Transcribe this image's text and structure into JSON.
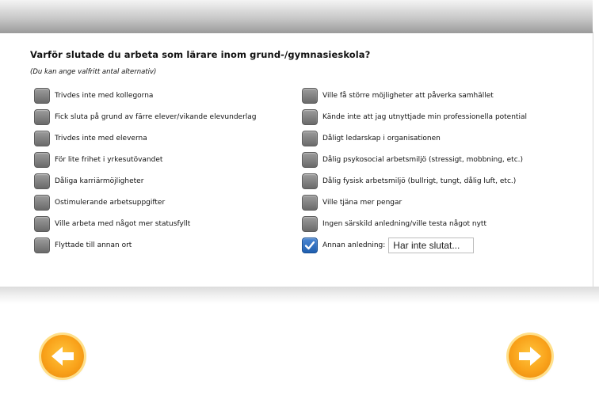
{
  "question": "Varför slutade du arbeta som lärare inom grund-/gymnasieskola?",
  "hint": "(Du kan ange valfritt antal alternativ)",
  "left_options": [
    {
      "label": "Trivdes inte med kollegorna",
      "checked": false
    },
    {
      "label": "Fick sluta på grund av färre elever/vikande elevunderlag",
      "checked": false
    },
    {
      "label": "Trivdes inte med eleverna",
      "checked": false
    },
    {
      "label": "För lite frihet i yrkesutövandet",
      "checked": false
    },
    {
      "label": "Dåliga karriärmöjligheter",
      "checked": false
    },
    {
      "label": "Ostimulerande arbetsuppgifter",
      "checked": false
    },
    {
      "label": "Ville arbeta med något mer statusfyllt",
      "checked": false
    },
    {
      "label": "Flyttade till annan ort",
      "checked": false
    }
  ],
  "right_options": [
    {
      "label": "Ville få större möjligheter att påverka samhället",
      "checked": false
    },
    {
      "label": "Kände inte att jag utnyttjade min professionella potential",
      "checked": false
    },
    {
      "label": "Dåligt ledarskap i organisationen",
      "checked": false
    },
    {
      "label": "Dålig psykosocial arbetsmiljö (stressigt, mobbning, etc.)",
      "checked": false
    },
    {
      "label": "Dålig fysisk arbetsmiljö (bullrigt, tungt, dålig luft, etc.)",
      "checked": false
    },
    {
      "label": "Ville tjäna mer pengar",
      "checked": false
    },
    {
      "label": "Ingen särskild anledning/ville testa något nytt",
      "checked": false
    },
    {
      "label": "Annan anledning:",
      "checked": true
    }
  ],
  "other_reason": {
    "value": "Har inte slutat..."
  },
  "nav": {
    "prev_icon": "arrow-left-icon",
    "next_icon": "arrow-right-icon",
    "button_color": "#f9a21a"
  }
}
